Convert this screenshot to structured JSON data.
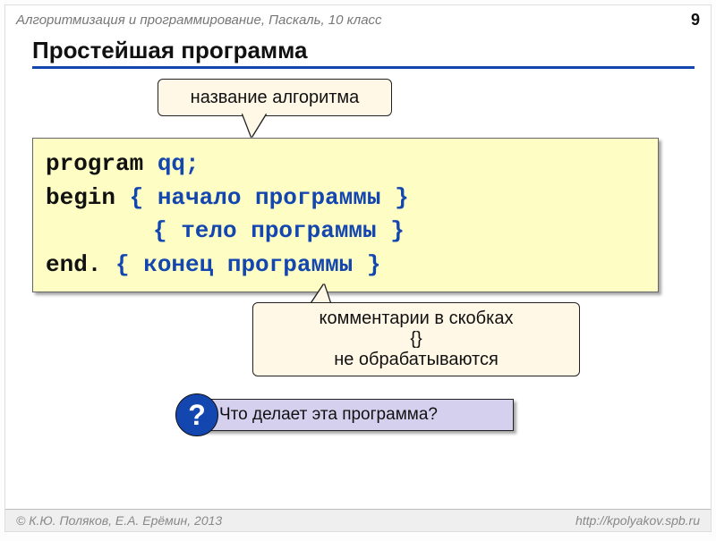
{
  "header": {
    "course": "Алгоритмизация и программирование, Паскаль, 10 класс",
    "pagenum": "9"
  },
  "title": "Простейшая программа",
  "callout_top": "название алгоритма",
  "code": {
    "l1_kw": "program",
    "l1_rest": " qq;",
    "l2_kw": "begin",
    "l2_c": " { начало программы }",
    "l3_c": "{ тело программы }",
    "l4_kw": "end.",
    "l4_c": "  { конец программы }"
  },
  "callout_bot_line1": "комментарии в скобках",
  "callout_bot_line2": "{}",
  "callout_bot_line3": "не обрабатываются",
  "question_mark": "?",
  "question_text": "Что делает эта программа?",
  "footer": {
    "authors": "© К.Ю. Поляков, Е.А. Ерёмин, 2013",
    "url": "http://kpolyakov.spb.ru"
  }
}
